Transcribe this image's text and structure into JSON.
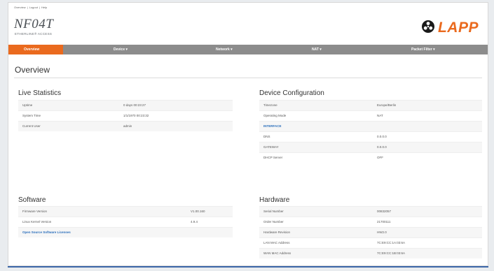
{
  "header": {
    "toplinks": [
      "Overview",
      "|",
      "Logout",
      "|",
      "Help"
    ],
    "product_name": "NF04T",
    "product_subtitle": "ETHERLINE® ACCESS",
    "brand_name": "LAPP",
    "brand_color": "#ea6a1e"
  },
  "nav": {
    "items": [
      {
        "label": "Overview",
        "active": true
      },
      {
        "label": "Device ▾",
        "active": false
      },
      {
        "label": "Network ▾",
        "active": false
      },
      {
        "label": "NAT ▾",
        "active": false
      },
      {
        "label": "Packet Filter ▾",
        "active": false
      }
    ]
  },
  "page_title": "Overview",
  "live_statistics": {
    "title": "Live Statistics",
    "rows": [
      {
        "label": "Uptime",
        "value": "0 days 00:23:27"
      },
      {
        "label": "System Time",
        "value": "1/1/1970 00:23:32"
      },
      {
        "label": "Current User",
        "value": "admin"
      }
    ]
  },
  "device_configuration": {
    "title": "Device Configuration",
    "rows": [
      {
        "label": "Timezone",
        "value": "Europe/Berlin"
      },
      {
        "label": "Operating Mode",
        "value": "NAT"
      },
      {
        "label": "INTERFACE",
        "value": ""
      },
      {
        "label": "DNS",
        "value": "0.0.0.0"
      },
      {
        "label": "GATEWAY",
        "value": "0.0.0.0"
      },
      {
        "label": "DHCP Server",
        "value": "OFF"
      }
    ]
  },
  "software": {
    "title": "Software",
    "rows": [
      {
        "label": "Firmware Version",
        "value": "V1.00.160"
      },
      {
        "label": "Linux Kernel Version",
        "value": "4.9.4"
      }
    ],
    "licenses_link": "Open Source Software Licenses"
  },
  "hardware": {
    "title": "Hardware",
    "rows": [
      {
        "label": "Serial Number",
        "value": "00832057"
      },
      {
        "label": "Order Number",
        "value": "21700111"
      },
      {
        "label": "Hardware Revision",
        "value": "HW2.0"
      },
      {
        "label": "LAN MAC Address",
        "value": "7C:E9:CC:1A:03:6A"
      },
      {
        "label": "WAN MAC Address",
        "value": "7C:E9:CC:1B:03:6A"
      }
    ]
  }
}
